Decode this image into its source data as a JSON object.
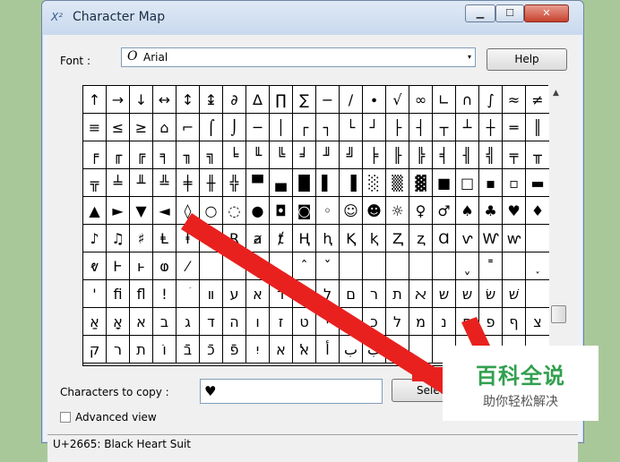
{
  "window": {
    "title": "Character Map",
    "icon_text": "X²",
    "controls": {
      "minimize": "▁",
      "maximize": "☐",
      "close": "✕"
    }
  },
  "font_picker": {
    "label": "Font :",
    "icon": "Ο",
    "value": "Arial",
    "dropdown_arrow": "▾"
  },
  "help_button": {
    "label": "Help"
  },
  "grid": {
    "rows": [
      [
        "↑",
        "→",
        "↓",
        "↔",
        "↕",
        "↨",
        "∂",
        "∆",
        "∏",
        "∑",
        "−",
        "∕",
        "∙",
        "√",
        "∞",
        "∟",
        "∩",
        "∫",
        "≈",
        "≠"
      ],
      [
        "≡",
        "≤",
        "≥",
        "⌂",
        "⌐",
        "⌠",
        "⌡",
        "─",
        "│",
        "┌",
        "┐",
        "└",
        "┘",
        "├",
        "┤",
        "┬",
        "┴",
        "┼",
        "═",
        "║"
      ],
      [
        "╒",
        "╓",
        "╔",
        "╕",
        "╖",
        "╗",
        "╘",
        "╙",
        "╚",
        "╛",
        "╜",
        "╝",
        "╞",
        "╟",
        "╠",
        "╡",
        "╢",
        "╣",
        "╤",
        "╥"
      ],
      [
        "╦",
        "╧",
        "╨",
        "╩",
        "╪",
        "╫",
        "╬",
        "▀",
        "▄",
        "█",
        "▌",
        "▐",
        "░",
        "▒",
        "▓",
        "■",
        "□",
        "▪",
        "▫",
        "▬"
      ],
      [
        "▲",
        "►",
        "▼",
        "◄",
        "◊",
        "○",
        "◌",
        "●",
        "◘",
        "◙",
        "◦",
        "☺",
        "☻",
        "☼",
        "♀",
        "♂",
        "♠",
        "♣",
        "♥",
        "♦"
      ],
      [
        "♪",
        "♫",
        "♯",
        "Ⱡ",
        "ⱡ",
        "Ᵽ",
        "Ɽ",
        "ⱥ",
        "ⱦ",
        "Ⱨ",
        "ⱨ",
        "Ⱪ",
        "ⱪ",
        "Ⱬ",
        "ⱬ",
        "Ɑ",
        "ⱱ",
        "Ⱳ",
        "ⱳ",
        ""
      ],
      [
        "ⱴ",
        "Ⱶ",
        "ⱶ",
        "ⱷ",
        "⁄",
        "",
        "",
        "",
        "",
        "ˆ",
        "ˇ",
        "",
        "",
        "",
        "",
        "",
        "ˬ",
        "˭",
        "",
        "˯"
      ],
      [
        "'",
        "ﬁ",
        "ﬂ",
        "!",
        "ؘ",
        "װ",
        "ע",
        "א",
        "ד",
        "נ",
        "ל",
        "ם",
        "ר",
        "ת",
        "ﬡ",
        "ש",
        "ש",
        "שׂ",
        "שׁ",
        ""
      ],
      [
        "אַ",
        "אָ",
        "א",
        "ב",
        "ג",
        "ד",
        "ה",
        "ו",
        "ז",
        "ט",
        "י",
        "ך",
        "כ",
        "ל",
        "מ",
        "נ",
        "ס",
        "פ",
        "ף",
        "צ"
      ],
      [
        "ק",
        "ר",
        "ת",
        "וֹ",
        "בֿ",
        "כֿ",
        "פֿ",
        "יִ",
        "א",
        "ﭏ",
        "أ",
        "ب",
        "ب",
        "ب",
        "",
        "",
        "",
        "",
        "",
        ""
      ]
    ]
  },
  "scrollbar": {
    "up_arrow": "▲"
  },
  "copy": {
    "label": "Characters to copy :",
    "value": "♥"
  },
  "select_button": {
    "label": "Selec"
  },
  "advanced_view": {
    "label": "Advanced view"
  },
  "status": {
    "text": "U+2665: Black Heart Suit"
  },
  "watermark": {
    "main": "百科全说",
    "sub": "助你轻松解决"
  },
  "colors": {
    "overlay_arrow": "#e8211f",
    "watermark_green": "#32a04f"
  }
}
